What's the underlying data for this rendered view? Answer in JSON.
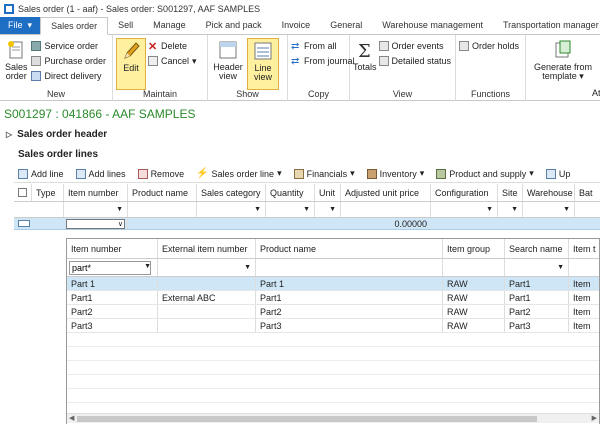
{
  "window": {
    "title": "Sales order (1 - aaf) - Sales order: S001297, AAF SAMPLES"
  },
  "tabs": [
    "File",
    "Sales order",
    "Sell",
    "Manage",
    "Pick and pack",
    "Invoice",
    "General",
    "Warehouse management",
    "Transportation manager"
  ],
  "file_arrow": "▾",
  "ribbon": {
    "new": {
      "label": "New",
      "sales_order": "Sales order",
      "service_order": "Service order",
      "purchase_order": "Purchase order",
      "direct_delivery": "Direct delivery"
    },
    "maintain": {
      "label": "Maintain",
      "edit": "Edit",
      "delete": "Delete",
      "cancel": "Cancel"
    },
    "show": {
      "label": "Show",
      "header_view": "Header view",
      "line_view": "Line view"
    },
    "copy": {
      "label": "Copy",
      "from_all": "From all",
      "from_journal": "From journal"
    },
    "view": {
      "label": "View",
      "totals": "Totals",
      "order_events": "Order events",
      "detailed_status": "Detailed status"
    },
    "functions": {
      "label": "Functions",
      "order_holds": "Order holds"
    },
    "generate": {
      "label": "Generate from template",
      "label_next": "At"
    }
  },
  "page": {
    "heading": "S001297 : 041866 - AAF SAMPLES",
    "header_section": "Sales order header",
    "lines_section": "Sales order lines",
    "expander": "▷"
  },
  "line_toolbar": [
    "Add line",
    "Add lines",
    "Remove",
    "Sales order line",
    "Financials",
    "Inventory",
    "Product and supply",
    "Up"
  ],
  "grid": {
    "columns": [
      "Type",
      "Item number",
      "Product name",
      "Sales category",
      "Quantity",
      "Unit",
      "Adjusted unit price",
      "Configuration",
      "Site",
      "Warehouse",
      "Bat"
    ],
    "row": {
      "price": "0.00000"
    }
  },
  "lookup": {
    "columns": [
      "Item number",
      "External item number",
      "Product name",
      "Item group",
      "Search name",
      "Item t"
    ],
    "filter_value": "part*",
    "rows": [
      [
        "Part 1",
        "",
        "Part 1",
        "RAW",
        "Part1",
        "Item"
      ],
      [
        "Part1",
        "External ABC",
        "Part1",
        "RAW",
        "Part1",
        "Item"
      ],
      [
        "Part2",
        "",
        "Part2",
        "RAW",
        "Part2",
        "Item"
      ],
      [
        "Part3",
        "",
        "Part3",
        "RAW",
        "Part3",
        "Item"
      ]
    ]
  },
  "colors": {
    "accent": "#1e6fc4",
    "heading": "#2a8a2a",
    "selection": "#cfe6f7",
    "active_button": "#fff0a0"
  }
}
